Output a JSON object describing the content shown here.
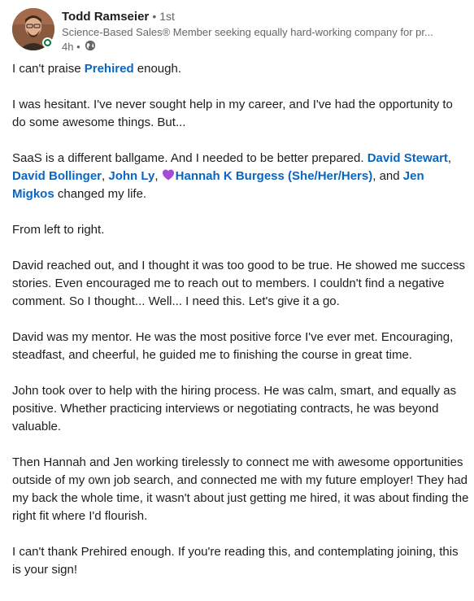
{
  "author": {
    "name": "Todd Ramseier",
    "degree": "• 1st",
    "headline": "Science-Based Sales® Member seeking equally hard-working company for pr...",
    "time": "4h •"
  },
  "post": {
    "p1": {
      "a": "I can't praise ",
      "link": "Prehired",
      "b": " enough."
    },
    "p2": "I was hesitant. I've never sought help in my career, and I've had the opportunity to do some awesome things. But...",
    "p3": {
      "a": "SaaS is a different ballgame. And I needed to be better prepared. ",
      "m1": "David Stewart",
      "s1": ", ",
      "m2": "David Bollinger",
      "s2": ", ",
      "m3": "John Ly",
      "s3": ", ",
      "m4": "Hannah K Burgess (She/Her/Hers)",
      "s4": ", and ",
      "m5": "Jen Migkos",
      "b": " changed my life."
    },
    "p4": "From left to right.",
    "p5": "David reached out, and I thought it was too good to be true. He showed me success stories. Even encouraged me to reach out to members. I couldn't find a negative comment. So I thought... Well... I need this. Let's give it a go.",
    "p6": "David was my mentor. He was the most positive force I've ever met. Encouraging, steadfast, and cheerful, he guided me to finishing the course in great time.",
    "p7": "John took over to help with the hiring process. He was calm, smart, and equally as positive. Whether practicing interviews or negotiating contracts, he was beyond valuable.",
    "p8": "Then Hannah and Jen working tirelessly to connect me with awesome opportunities outside of my own job search, and connected me with my future employer! They had my back the whole time, it wasn't about just getting me hired, it was about finding the right fit where I'd flourish.",
    "p9": "I can't thank Prehired enough. If you're reading this, and contemplating joining, this is your sign!"
  },
  "colors": {
    "link": "#0a66c2",
    "text": "#1d1d1d",
    "muted": "#666666",
    "online": "#057642",
    "heart": "#a64ad9"
  },
  "icons": {
    "globe": "globe-icon",
    "heart": "purple-heart-icon",
    "online": "online-status-icon"
  }
}
